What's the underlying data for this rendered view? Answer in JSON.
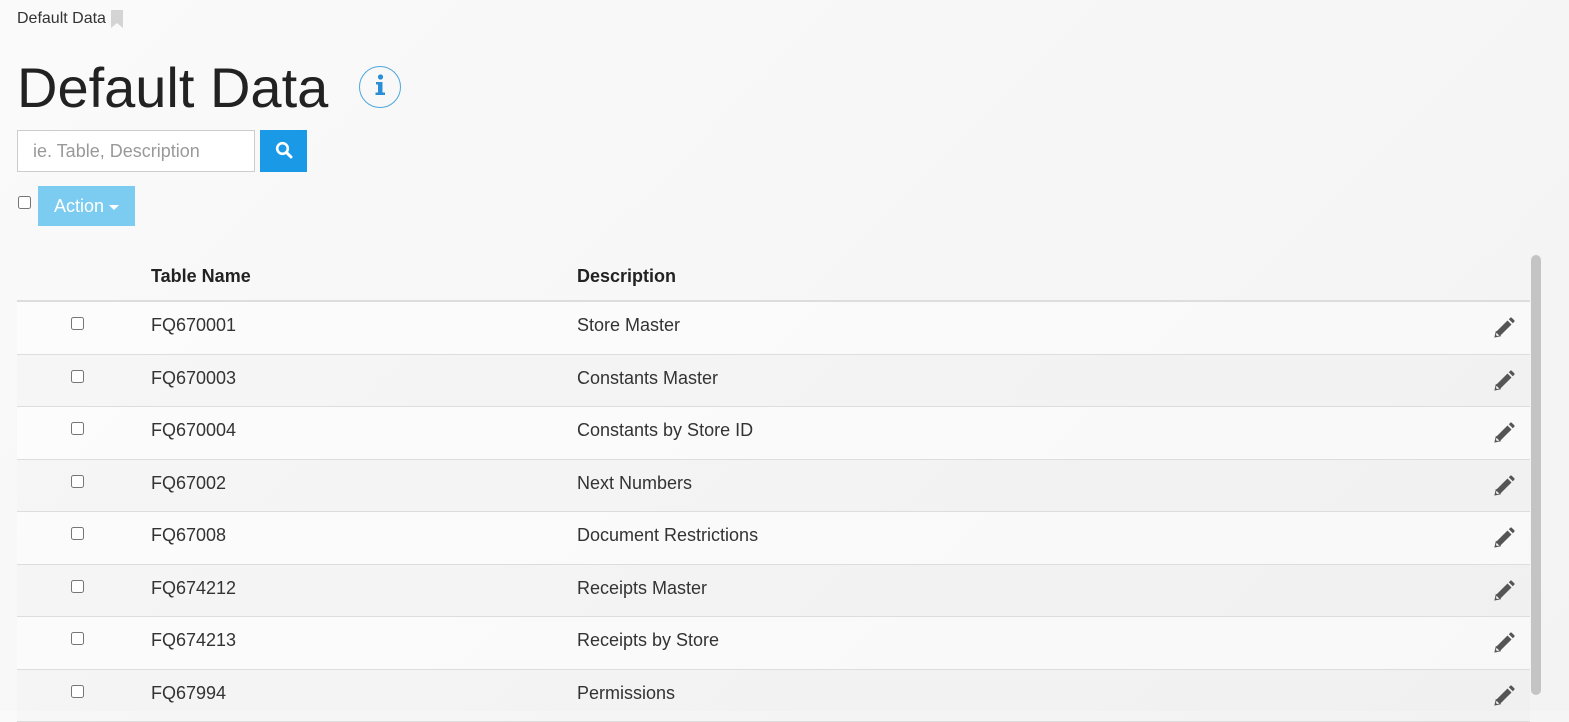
{
  "breadcrumb": {
    "label": "Default Data"
  },
  "page": {
    "title": "Default Data"
  },
  "search": {
    "placeholder": "ie. Table, Description"
  },
  "toolbar": {
    "action_label": "Action"
  },
  "table": {
    "headers": {
      "name": "Table Name",
      "description": "Description"
    },
    "rows": [
      {
        "name": "FQ670001",
        "description": "Store Master"
      },
      {
        "name": "FQ670003",
        "description": "Constants Master"
      },
      {
        "name": "FQ670004",
        "description": "Constants by Store ID"
      },
      {
        "name": "FQ67002",
        "description": "Next Numbers"
      },
      {
        "name": "FQ67008",
        "description": "Document Restrictions"
      },
      {
        "name": "FQ674212",
        "description": "Receipts Master"
      },
      {
        "name": "FQ674213",
        "description": "Receipts by Store"
      },
      {
        "name": "FQ67994",
        "description": "Permissions"
      }
    ]
  },
  "colors": {
    "accent": "#1a9ae6",
    "action_button": "#7ccbf0",
    "info_icon": "#2a8fd6"
  },
  "icons": [
    "bookmark-icon",
    "info-icon",
    "search-icon",
    "caret-down-icon",
    "pencil-icon"
  ]
}
